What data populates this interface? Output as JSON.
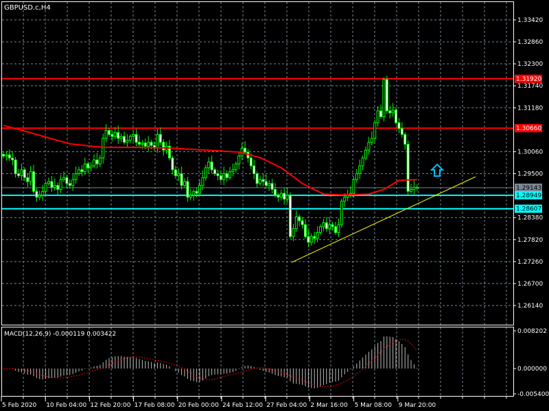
{
  "window": {
    "title": "GBPUSD.c,H4"
  },
  "colors": {
    "background": "#000000",
    "grid": "#778899",
    "candle": "#00ff00",
    "bear_body": "#ffffff",
    "ma": "#ff0000",
    "resistance": "#ff0000",
    "support": "#00ffff",
    "current": "#778899",
    "trendline": "#ffff00",
    "arrow": "#00bfff",
    "macd_hist": "#c0c0c0",
    "macd_signal": "#ff0000"
  },
  "price_axis": {
    "ticks": [
      "1.33420",
      "1.32860",
      "1.32300",
      "1.31740",
      "1.31180",
      "1.30060",
      "1.29500",
      "1.28380",
      "1.27820",
      "1.27260",
      "1.26700",
      "1.26140"
    ]
  },
  "price_tags": [
    {
      "label": "1.31920",
      "value": 1.3192,
      "kind": "resistance"
    },
    {
      "label": "1.30660",
      "value": 1.3066,
      "kind": "resistance"
    },
    {
      "label": "1.29143",
      "value": 1.29143,
      "kind": "current"
    },
    {
      "label": "1.28949",
      "value": 1.28949,
      "kind": "support"
    },
    {
      "label": "1.28607",
      "value": 1.28607,
      "kind": "support"
    }
  ],
  "macd": {
    "label": "MACD(12,26,9) -0.000119 0.003422",
    "ticks": [
      "0.008202",
      "0.000000",
      "-0.005400"
    ],
    "range": [
      -0.0054,
      0.008202
    ]
  },
  "time_axis": {
    "labels": [
      "5 Feb 2020",
      "10 Feb 04:00",
      "12 Feb 20:00",
      "17 Feb 08:00",
      "20 Feb 00:00",
      "24 Feb 12:00",
      "27 Feb 04:00",
      "2 Mar 16:00",
      "5 Mar 08:00",
      "9 Mar 20:00"
    ]
  },
  "chart_data": {
    "type": "candlestick",
    "symbol": "GBPUSD.c",
    "timeframe": "H4",
    "ylim": [
      1.2586,
      1.3372
    ],
    "closes": [
      1.2995,
      1.2998,
      1.299,
      1.2985,
      1.295,
      1.2945,
      1.296,
      1.294,
      1.293,
      1.2955,
      1.2905,
      1.289,
      1.2895,
      1.2905,
      1.2925,
      1.293,
      1.2915,
      1.292,
      1.291,
      1.2935,
      1.294,
      1.2925,
      1.292,
      1.2935,
      1.295,
      1.296,
      1.2955,
      1.2975,
      1.2965,
      1.297,
      1.2985,
      1.2975,
      1.299,
      1.304,
      1.306,
      1.305,
      1.3045,
      1.3055,
      1.304,
      1.3045,
      1.303,
      1.3035,
      1.3045,
      1.305,
      1.303,
      1.3025,
      1.3028,
      1.302,
      1.303,
      1.3022,
      1.3015,
      1.305,
      1.303,
      1.301,
      1.302,
      1.299,
      1.296,
      1.2945,
      1.295,
      1.292,
      1.293,
      1.289,
      1.2895,
      1.2905,
      1.29,
      1.292,
      1.294,
      1.2965,
      1.298,
      1.296,
      1.295,
      1.2945,
      1.2935,
      1.295,
      1.294,
      1.2955,
      1.296,
      1.2975,
      1.2995,
      1.3015,
      1.3005,
      1.299,
      1.297,
      1.295,
      1.2925,
      1.2935,
      1.293,
      1.292,
      1.2925,
      1.291,
      1.2895,
      1.289,
      1.29,
      1.2885,
      1.2895,
      1.279,
      1.281,
      1.284,
      1.283,
      1.282,
      1.279,
      1.2775,
      1.279,
      1.2785,
      1.28,
      1.2815,
      1.2825,
      1.281,
      1.282,
      1.2815,
      1.28,
      1.282,
      1.288,
      1.289,
      1.2895,
      1.29,
      1.2935,
      1.295,
      1.297,
      1.299,
      1.301,
      1.303,
      1.304,
      1.308,
      1.311,
      1.3095,
      1.319,
      1.311,
      1.3105,
      1.3112,
      1.308,
      1.3065,
      1.305,
      1.3025,
      1.2905,
      1.291,
      1.2915,
      1.2914
    ],
    "moving_average": [
      [
        0,
        1.3073
      ],
      [
        10,
        1.3052
      ],
      [
        22,
        1.3026
      ],
      [
        33,
        1.3017
      ],
      [
        44,
        1.3017
      ],
      [
        56,
        1.3015
      ],
      [
        67,
        1.301
      ],
      [
        78,
        1.3005
      ],
      [
        85,
        1.2991
      ],
      [
        92,
        1.2965
      ],
      [
        99,
        1.2925
      ],
      [
        106,
        1.2898
      ],
      [
        112,
        1.2896
      ],
      [
        121,
        1.2898
      ],
      [
        126,
        1.291
      ],
      [
        131,
        1.2933
      ],
      [
        137,
        1.2935
      ]
    ],
    "trendline": [
      [
        95,
        1.2722
      ],
      [
        156,
        1.294
      ]
    ],
    "horizontal_levels": [
      1.3192,
      1.3066,
      1.28949,
      1.28607
    ]
  }
}
